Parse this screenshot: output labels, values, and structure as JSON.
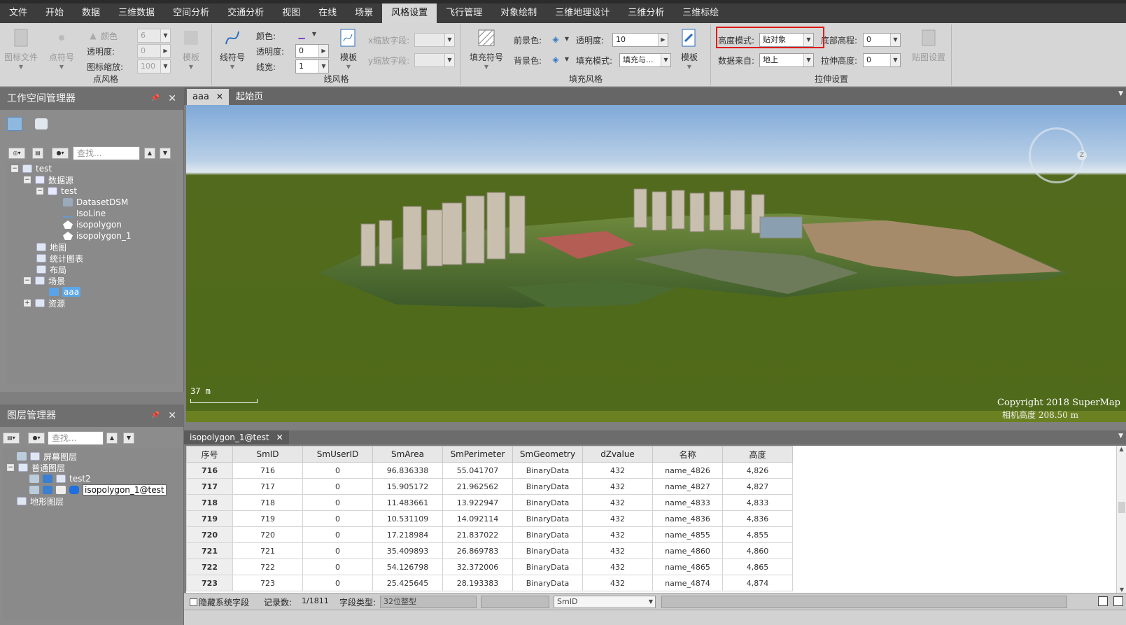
{
  "menu": {
    "items": [
      "文件",
      "开始",
      "数据",
      "三维数据",
      "空间分析",
      "交通分析",
      "视图",
      "在线",
      "场景",
      "风格设置",
      "飞行管理",
      "对象绘制",
      "三维地理设计",
      "三维分析",
      "三维标绘"
    ],
    "active_index": 9
  },
  "ribbon": {
    "point_style": {
      "title": "点风格",
      "icon_file": "图标文件",
      "point_symbol": "点符号",
      "color_label": "颜色",
      "opacity_label": "透明度:",
      "icon_scale_label": "图标缩放:",
      "size_value": "6",
      "opacity_value": "0",
      "scale_value": "100",
      "template": "模板"
    },
    "line_style": {
      "title": "线风格",
      "line_symbol": "线符号",
      "color_label": "颜色:",
      "opacity_label": "透明度:",
      "width_label": "线宽:",
      "opacity_value": "0",
      "width_value": "1",
      "template": "模板",
      "x_scale_label": "x缩放字段:",
      "y_scale_label": "y缩放字段:"
    },
    "fill_style": {
      "title": "填充风格",
      "fill_symbol": "填充符号",
      "fg_color_label": "前景色:",
      "bg_color_label": "背景色:",
      "opacity_label": "透明度:",
      "opacity_value": "10",
      "fill_mode_label": "填充模式:",
      "fill_mode_value": "填充与...",
      "template": "模板"
    },
    "extrude": {
      "title": "拉伸设置",
      "height_mode_label": "高度模式:",
      "height_mode_value": "贴对象",
      "data_source_label": "数据来自:",
      "data_source_value": "地上",
      "base_height_label": "底部高程:",
      "base_height_value": "0",
      "extrude_height_label": "拉伸高度:",
      "extrude_height_value": "0",
      "texture_settings": "贴图设置"
    }
  },
  "workspace": {
    "title": "工作空间管理器",
    "search_placeholder": "查找...",
    "tree": [
      "test",
      "数据源",
      "test",
      "DatasetDSM",
      "IsoLine",
      "isopolygon",
      "isopolygon_1",
      "地图",
      "统计图表",
      "布局",
      "场景",
      "aaa",
      "资源"
    ]
  },
  "layers": {
    "title": "图层管理器",
    "search_placeholder": "查找...",
    "tree": [
      "屏幕图层",
      "普通图层",
      "test2",
      "isopolygon_1@test",
      "地形图层"
    ]
  },
  "doc_tabs": [
    "aaa",
    "起始页"
  ],
  "scene": {
    "scale_text": "37 m",
    "copyright": "Copyright 2018 SuperMap",
    "camera_height": "相机高度 208.50 m"
  },
  "table": {
    "tab_label": "isopolygon_1@test",
    "columns": [
      "序号",
      "SmID",
      "SmUserID",
      "SmArea",
      "SmPerimeter",
      "SmGeometry",
      "dZvalue",
      "名称",
      "高度"
    ],
    "rows": [
      [
        "716",
        "716",
        "0",
        "96.836338",
        "55.041707",
        "BinaryData",
        "432",
        "name_4826",
        "4,826"
      ],
      [
        "717",
        "717",
        "0",
        "15.905172",
        "21.962562",
        "BinaryData",
        "432",
        "name_4827",
        "4,827"
      ],
      [
        "718",
        "718",
        "0",
        "11.483661",
        "13.922947",
        "BinaryData",
        "432",
        "name_4833",
        "4,833"
      ],
      [
        "719",
        "719",
        "0",
        "10.531109",
        "14.092114",
        "BinaryData",
        "432",
        "name_4836",
        "4,836"
      ],
      [
        "720",
        "720",
        "0",
        "17.218984",
        "21.837022",
        "BinaryData",
        "432",
        "name_4855",
        "4,855"
      ],
      [
        "721",
        "721",
        "0",
        "35.409893",
        "26.869783",
        "BinaryData",
        "432",
        "name_4860",
        "4,860"
      ],
      [
        "722",
        "722",
        "0",
        "54.126798",
        "32.372006",
        "BinaryData",
        "432",
        "name_4865",
        "4,865"
      ],
      [
        "723",
        "723",
        "0",
        "25.425645",
        "28.193383",
        "BinaryData",
        "432",
        "name_4874",
        "4,874"
      ]
    ]
  },
  "status": {
    "hide_fields": "隐藏系统字段",
    "records_label": "记录数:",
    "records_value": "1/1811",
    "field_type_label": "字段类型:",
    "field_type_value": "32位整型",
    "field_name_value": "SmID"
  },
  "colors": {
    "menubar": "#3c3c3c",
    "ribbon": "#d6d6d6",
    "highlight": "#e01a1a",
    "selection": "#5ba7e8",
    "terrain": "#526a1d"
  }
}
